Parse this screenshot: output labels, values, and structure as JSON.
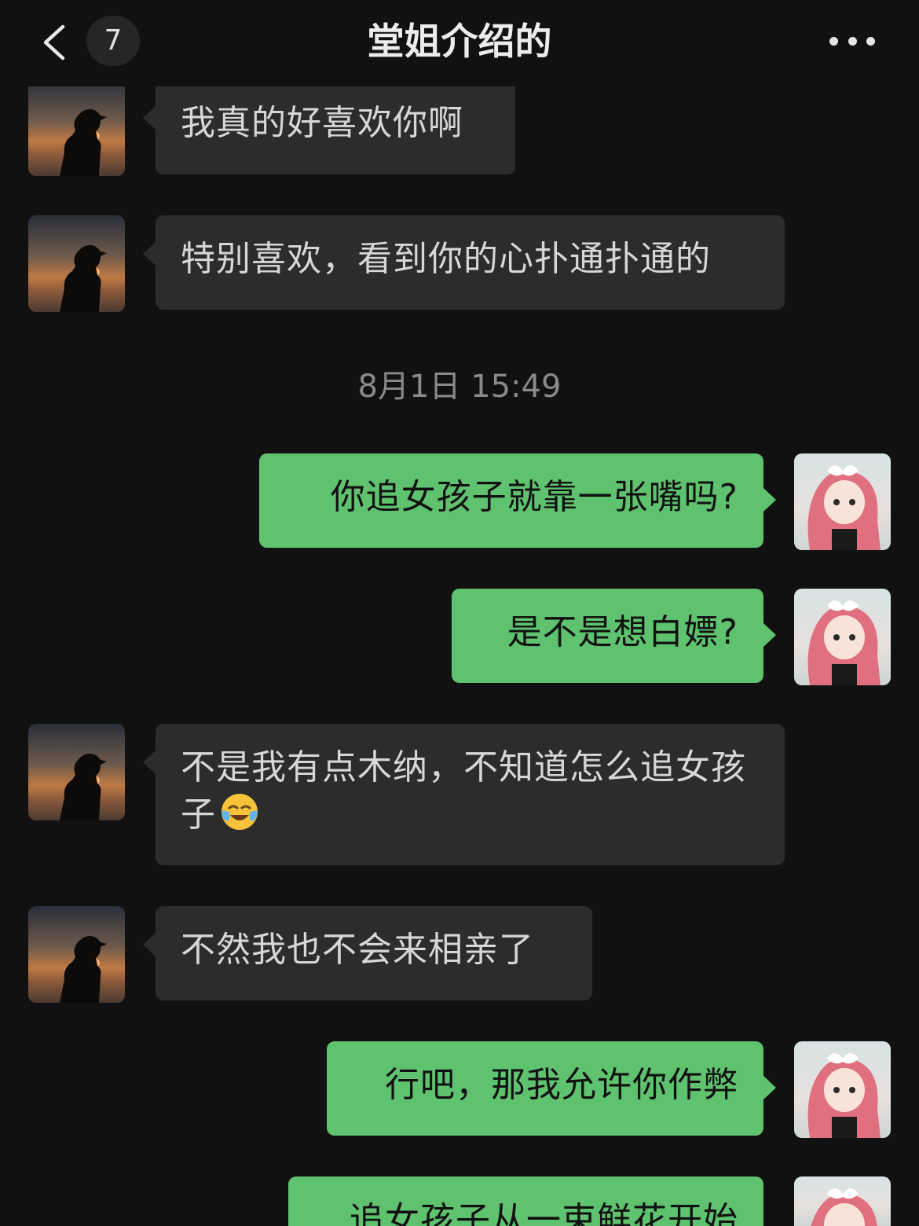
{
  "header": {
    "back_icon": "chevron-left-icon",
    "unread_count": "7",
    "title": "堂姐介绍的",
    "more_icon": "more-dots-icon"
  },
  "timestamp": "8月1日 15:49",
  "messages": [
    {
      "side": "in",
      "text": "我真的好喜欢你啊"
    },
    {
      "side": "in",
      "text": "特别喜欢，看到你的心扑通扑通的"
    },
    {
      "side": "out",
      "text": "你追女孩子就靠一张嘴吗?"
    },
    {
      "side": "out",
      "text": "是不是想白嫖?"
    },
    {
      "side": "in",
      "text": "不是我有点木纳，不知道怎么追女孩子",
      "emoji": "crying-laughing-emoji-icon"
    },
    {
      "side": "in",
      "text": "不然我也不会来相亲了"
    },
    {
      "side": "out",
      "text": "行吧，那我允许你作弊"
    },
    {
      "side": "out",
      "text": "追女孩子从一束鲜花开始"
    }
  ],
  "colors": {
    "background": "#111111",
    "incoming_bubble": "#2c2c2c",
    "outgoing_bubble": "#5fc26f"
  }
}
